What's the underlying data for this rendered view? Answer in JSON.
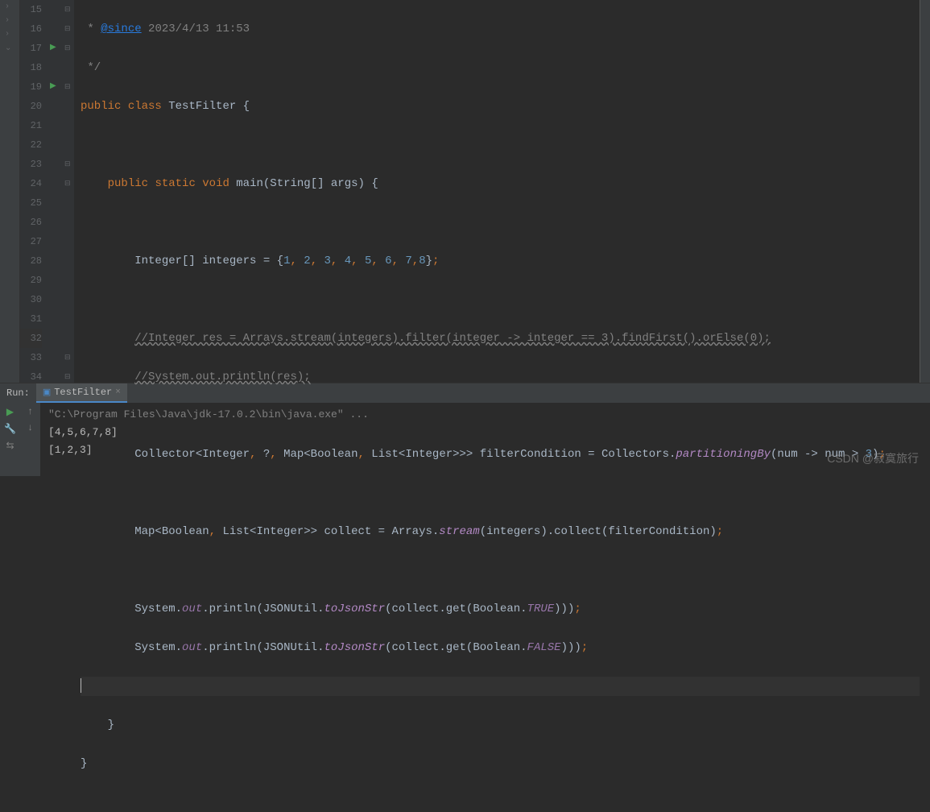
{
  "gutter": {
    "lines": [
      "15",
      "16",
      "17",
      "18",
      "19",
      "20",
      "21",
      "22",
      "23",
      "24",
      "25",
      "26",
      "27",
      "28",
      "29",
      "30",
      "31",
      "32",
      "33",
      "34"
    ],
    "current": "32",
    "runMarkers": {
      "17": true,
      "19": true
    },
    "foldOpen": {
      "15": "⊟",
      "17": "⊟",
      "19": "⊟"
    },
    "foldClose": {
      "16": "⊟",
      "23": "⊟",
      "24": "⊟",
      "33": "⊟",
      "34": "⊟"
    }
  },
  "code": {
    "l15": {
      "prefix": " * ",
      "since": "@since",
      "date": " 2023/4/13 11:53"
    },
    "l16": " */",
    "l17": {
      "kw1": "public",
      "kw2": "class",
      "name": "TestFilter",
      "brace": "{"
    },
    "l19": {
      "kw1": "public",
      "kw2": "static",
      "kw3": "void",
      "name": "main",
      "args": "(String[] args) {"
    },
    "l21": {
      "type": "Integer[]",
      "var": " integers = {",
      "nums": [
        "1",
        "2",
        "3",
        "4",
        "5",
        "6",
        "7",
        "8"
      ],
      "end": "};"
    },
    "l23": "//Integer res = Arrays.stream(integers).filter(integer -> integer == 3).findFirst().orElse(0);",
    "l24": "//System.out.println(res);",
    "l26": {
      "pre": "Collector<Integer",
      "c1": ",",
      "q": " ?",
      "c2": ",",
      "map": " Map<Boolean",
      "c3": ",",
      "list": " List<Integer>>> filterCondition = Collectors.",
      "method": "partitioningBy",
      "post": "(num -> num > ",
      "n": "3",
      "end": ");"
    },
    "l28": {
      "pre": "Map<Boolean",
      "c1": ",",
      "mid": " List<Integer>> collect = Arrays.",
      "method": "stream",
      "post": "(integers).collect(filterCondition)",
      "semi": ";"
    },
    "l30": {
      "sys": "System.",
      "out": "out",
      "print": ".println(JSONUtil.",
      "tojson": "toJsonStr",
      "mid": "(collect.get(Boolean.",
      "bool": "TRUE",
      "end": ")));"
    },
    "l31": {
      "sys": "System.",
      "out": "out",
      "print": ".println(JSONUtil.",
      "tojson": "toJsonStr",
      "mid": "(collect.get(Boolean.",
      "bool": "FALSE",
      "end": ")));"
    },
    "l33": "    }",
    "l34": "}"
  },
  "run": {
    "label": "Run:",
    "tab": "TestFilter",
    "output": {
      "cmd": "\"C:\\Program Files\\Java\\jdk-17.0.2\\bin\\java.exe\" ...",
      "l1": "[4,5,6,7,8]",
      "l2": "[1,2,3]"
    }
  },
  "watermark": "CSDN @寂寞旅行"
}
